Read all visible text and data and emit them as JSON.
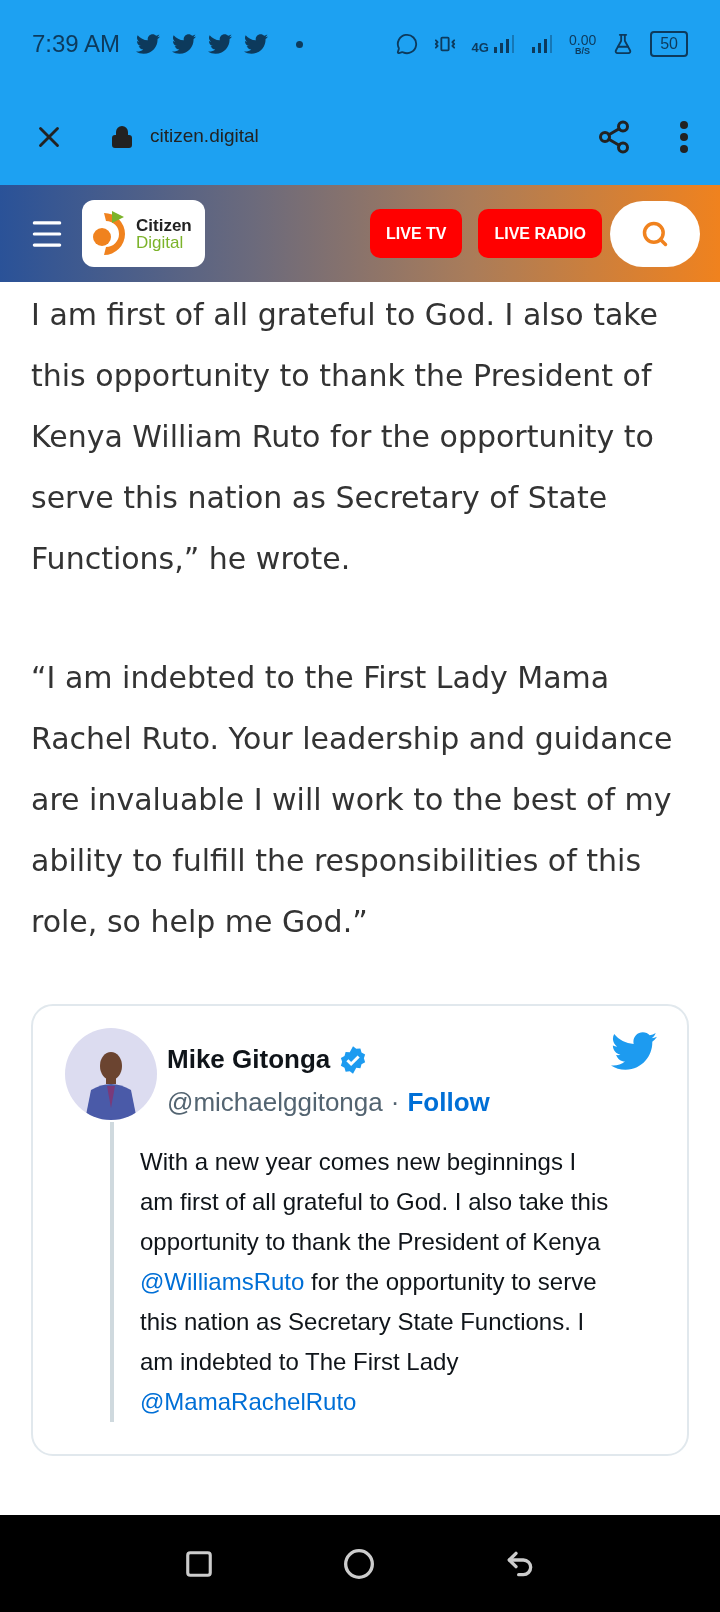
{
  "status_bar": {
    "time": "7:39 AM",
    "network": "4G",
    "speed": "0.00",
    "speed_unit": "B/S",
    "battery": "50"
  },
  "browser": {
    "url": "citizen.digital"
  },
  "site_header": {
    "logo_top": "Citizen",
    "logo_bottom": "Digital",
    "buttons": [
      "LIVE TV",
      "LIVE RADIO"
    ]
  },
  "article": {
    "paragraphs": [
      "I am first of all grateful to God. I also take this opportunity to thank the President of Kenya William Ruto for the opportunity to serve this nation as Secretary of State Functions,” he wrote.",
      "“I am indebted to the First Lady Mama Rachel Ruto. Your leadership and guidance are invaluable I will work to the best of my ability to fulfill the responsibilities of this role, so help me God.”"
    ]
  },
  "tweet": {
    "name": "Mike Gitonga",
    "handle": "@michaelggitonga",
    "separator": "·",
    "follow": "Follow",
    "verified": true,
    "text": [
      {
        "kind": "text",
        "text": "With a new year comes new beginnings I am first of all grateful to God. I also take this opportunity to thank the President of Kenya "
      },
      {
        "kind": "mention",
        "text": "@WilliamsRuto"
      },
      {
        "kind": "text",
        "text": " for the opportunity to serve this nation as Secretary State Functions. I am indebted to The First Lady "
      },
      {
        "kind": "mention",
        "text": "@MamaRachelRuto"
      }
    ]
  }
}
